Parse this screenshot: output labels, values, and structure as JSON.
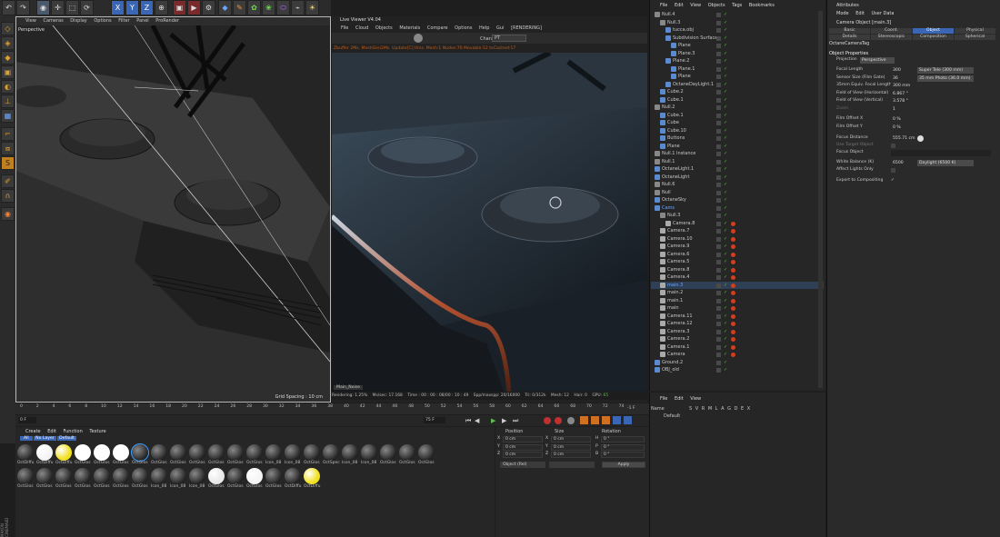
{
  "left_viewport": {
    "menu": [
      "View",
      "Cameras",
      "Display",
      "Options",
      "Filter",
      "Panel",
      "ProRender"
    ],
    "camera_label": "Perspective",
    "grid_spacing": "Grid Spacing : 10 cm"
  },
  "toolbar": {
    "axis_x": "X",
    "axis_y": "Y",
    "axis_z": "Z"
  },
  "live_viewer": {
    "title": "Live Viewer V4.04",
    "menu": [
      "File",
      "Cloud",
      "Objects",
      "Materials",
      "Compare",
      "Options",
      "Help",
      "Gui"
    ],
    "status": "[RENDERING]",
    "channel_label": "Chan:",
    "channel_value": "PT",
    "info_line": "Zbuffer 2Ms. MeshGen2Ms. Update[C]:0ms. Mesh:1 Nodes:70 Movable:12 txCached:17",
    "bottom_tab": "Main_Noise",
    "stats": {
      "rendering": "Rendering: 1.25%",
      "ms_sec": "Ms/sec: 17.168",
      "time": "Time : 00 : 00 : 08/00 : 10 : 49",
      "spp": "Spp/maxspp: 20/16000",
      "tri": "Tri: 0/312k",
      "mesh": "Mesh: 12",
      "hair": "Hair: 0",
      "gpu_label": "GPU:",
      "gpu_temp": "65"
    }
  },
  "object_manager": {
    "menu": [
      "File",
      "Edit",
      "View",
      "Objects",
      "Tags",
      "Bookmarks"
    ],
    "items": [
      {
        "name": "Null.4",
        "indent": 0
      },
      {
        "name": "Null.3",
        "indent": 1
      },
      {
        "name": "tucca.obj",
        "indent": 2
      },
      {
        "name": "Subdivision Surface",
        "indent": 2
      },
      {
        "name": "Plane",
        "indent": 3
      },
      {
        "name": "Plane.3",
        "indent": 3
      },
      {
        "name": "Plane.2",
        "indent": 2
      },
      {
        "name": "Plane.1",
        "indent": 3
      },
      {
        "name": "Plane",
        "indent": 3
      },
      {
        "name": "OctaneDayLight.1",
        "indent": 2
      },
      {
        "name": "Cube.2",
        "indent": 1
      },
      {
        "name": "Cube.1",
        "indent": 1
      },
      {
        "name": "Null.2",
        "indent": 0
      },
      {
        "name": "Cube.1",
        "indent": 1
      },
      {
        "name": "Cube",
        "indent": 1
      },
      {
        "name": "Cube.10",
        "indent": 1
      },
      {
        "name": "Buttons",
        "indent": 1
      },
      {
        "name": "Plane",
        "indent": 1
      },
      {
        "name": "Null.1 Instance",
        "indent": 0
      },
      {
        "name": "Null.1",
        "indent": 0
      },
      {
        "name": "OctaneLight.1",
        "indent": 0
      },
      {
        "name": "OctaneLight",
        "indent": 0
      },
      {
        "name": "Null.6",
        "indent": 0
      },
      {
        "name": "Null",
        "indent": 0
      },
      {
        "name": "OctaneSky",
        "indent": 0
      },
      {
        "name": "Cams",
        "indent": 0
      },
      {
        "name": "Null.3",
        "indent": 1
      },
      {
        "name": "Camera.8",
        "indent": 2
      },
      {
        "name": "Camera.7",
        "indent": 1
      },
      {
        "name": "Camera.10",
        "indent": 1
      },
      {
        "name": "Camera.9",
        "indent": 1
      },
      {
        "name": "Camera.6",
        "indent": 1
      },
      {
        "name": "Camera.5",
        "indent": 1
      },
      {
        "name": "Camera.8",
        "indent": 1
      },
      {
        "name": "Camera.4",
        "indent": 1
      },
      {
        "name": "main.3",
        "indent": 1
      },
      {
        "name": "main.2",
        "indent": 1
      },
      {
        "name": "main.1",
        "indent": 1
      },
      {
        "name": "main",
        "indent": 1
      },
      {
        "name": "Camera.11",
        "indent": 1
      },
      {
        "name": "Camera.12",
        "indent": 1
      },
      {
        "name": "Camera.3",
        "indent": 1
      },
      {
        "name": "Camera.2",
        "indent": 1
      },
      {
        "name": "Camera.1",
        "indent": 1
      },
      {
        "name": "Camera",
        "indent": 1
      },
      {
        "name": "Ground.2",
        "indent": 0
      },
      {
        "name": "OBJ_old",
        "indent": 0
      }
    ]
  },
  "layers_panel": {
    "menu": [
      "File",
      "Edit",
      "View"
    ],
    "col_name": "Name",
    "cols": "S V R M L A G D E X",
    "row": "Default"
  },
  "attributes": {
    "title": "Attributes",
    "menu": [
      "Mode",
      "Edit",
      "User Data"
    ],
    "object_title": "Camera Object [main.3]",
    "tabs_row1": [
      "Basic",
      "Coord.",
      "Object",
      "Physical"
    ],
    "tabs_row2": [
      "Details",
      "Stereoscopic",
      "Composition",
      "Spherical"
    ],
    "tag_label": "OctaneCameraTag",
    "section": "Object Properties",
    "projection_label": "Projection",
    "projection_value": "Perspective",
    "rows": [
      {
        "label": "Focal Length",
        "value": "300",
        "dropdown": "Super Tele (300 mm)"
      },
      {
        "label": "Sensor Size (Film Gate)",
        "value": "36",
        "dropdown": "35 mm Photo (36.0 mm)"
      },
      {
        "label": "35mm Equiv. Focal Length:",
        "value": "300 mm",
        "dropdown": ""
      },
      {
        "label": "Field of View (Horizontal)",
        "value": "6.867 °",
        "dropdown": ""
      },
      {
        "label": "Field of View (Vertical)",
        "value": "3.578 °",
        "dropdown": ""
      },
      {
        "label": "Zoom",
        "value": "1",
        "dropdown": ""
      }
    ],
    "rows2": [
      {
        "label": "Film Offset X",
        "value": "0 %"
      },
      {
        "label": "Film Offset Y",
        "value": "0 %"
      }
    ],
    "focus_distance_label": "Focus Distance",
    "focus_distance_value": "555.71 cm",
    "use_target_label": "Use Target Object",
    "focus_object_label": "Focus Object",
    "white_balance_label": "White Balance (K)",
    "white_balance_value": "6500",
    "white_balance_preset": "Daylight (6500 K)",
    "affect_lights_label": "Affect Lights Only",
    "export_label": "Export to Compositing"
  },
  "timeline": {
    "ticks": [
      "0",
      "2",
      "4",
      "6",
      "8",
      "10",
      "12",
      "14",
      "16",
      "18",
      "20",
      "22",
      "24",
      "26",
      "28",
      "30",
      "32",
      "34",
      "36",
      "38",
      "40",
      "42",
      "44",
      "46",
      "48",
      "50",
      "52",
      "54",
      "56",
      "58",
      "60",
      "62",
      "64",
      "66",
      "68",
      "70",
      "72",
      "74"
    ],
    "current_frame": "0 F",
    "start_field": "0 F",
    "end_field": "75 F",
    "end_frame": "-1 F"
  },
  "material_manager": {
    "menu": [
      "Create",
      "Edit",
      "Function",
      "Texture"
    ],
    "filters": [
      "All",
      "No Layer",
      "Default"
    ],
    "row1": [
      "OctDiffu",
      "OctDiffu",
      "OctDiffu",
      "OctGlos",
      "OctGlos",
      "OctGlos",
      "OctGlos",
      "OctGlos",
      "OctGlos",
      "OctGlos",
      "OctGlos",
      "OctGlos",
      "OctGlos",
      "Icon_08",
      "Icon_08",
      "OctGlos",
      "OctSpec",
      "Icon_08",
      "Icon_08",
      "OctGlos",
      "OctGlos",
      "OctGlos"
    ],
    "row2": [
      "OctGlos",
      "OctGlos",
      "OctGlos",
      "OctGlos",
      "OctGlos",
      "OctGlos",
      "OctGlos",
      "Icon_08",
      "Icon_08",
      "Icon_08",
      "OctGlos",
      "OctGlos",
      "OctGlos",
      "OctGlos",
      "OctDiffu",
      "OctDiffu"
    ]
  },
  "coordinates": {
    "position": "Position",
    "size": "Size",
    "rotation": "Rotation",
    "x": "X",
    "y": "Y",
    "z": "Z",
    "pos_vals": [
      "0 cm",
      "0 cm",
      "0 cm"
    ],
    "size_vals": [
      "0 cm",
      "0 cm",
      "0 cm"
    ],
    "rot_labels": [
      "H",
      "P",
      "B"
    ],
    "rot_vals": [
      "0 °",
      "0 °",
      "0 °"
    ],
    "mode": "Object (Rel)",
    "apply": "Apply"
  },
  "brand": "MAXON CINEMA4D"
}
